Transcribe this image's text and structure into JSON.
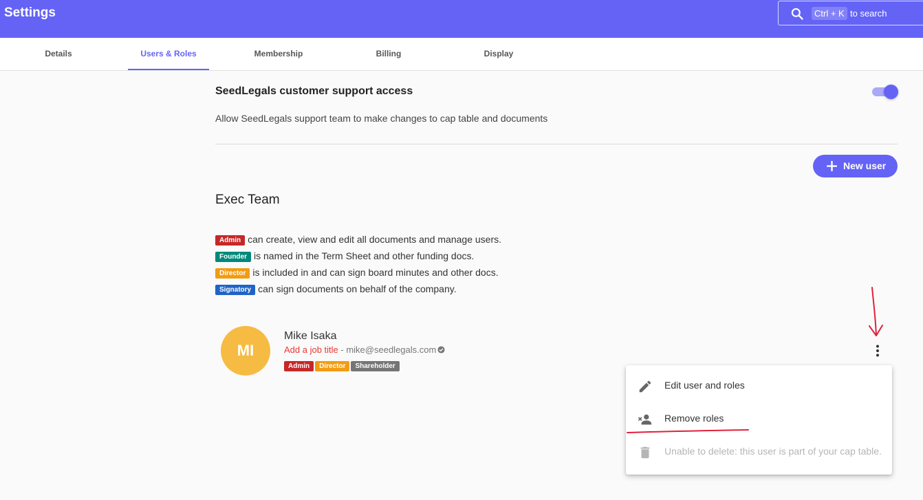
{
  "app": {
    "title": "Settings"
  },
  "search": {
    "shortcut": "Ctrl + K",
    "hint": "to search"
  },
  "tabs": [
    {
      "label": "Details"
    },
    {
      "label": "Users & Roles"
    },
    {
      "label": "Membership"
    },
    {
      "label": "Billing"
    },
    {
      "label": "Display"
    }
  ],
  "support": {
    "title": "SeedLegals customer support access",
    "description": "Allow SeedLegals support team to make changes to cap table and documents",
    "enabled": true
  },
  "actions": {
    "new_user_label": "New user"
  },
  "group": {
    "title": "Exec Team",
    "roles": [
      {
        "chip": "Admin",
        "text": "can create, view and edit all documents and manage users.",
        "color": "#c62828"
      },
      {
        "chip": "Founder",
        "text": "is named in the Term Sheet and other funding docs.",
        "color": "#00897b"
      },
      {
        "chip": "Director",
        "text": "is included in and can sign board minutes and other docs.",
        "color": "#f29c12"
      },
      {
        "chip": "Signatory",
        "text": "can sign documents on behalf of the company.",
        "color": "#1e64c8"
      }
    ]
  },
  "user": {
    "initials": "MI",
    "name": "Mike Isaka",
    "job_title_prompt": "Add a job title",
    "separator": " - ",
    "email": "mike@seedlegals.com",
    "roles": [
      "Admin",
      "Director",
      "Shareholder"
    ]
  },
  "menu": {
    "items": [
      {
        "label": "Edit user and roles",
        "icon": "pencil-icon",
        "disabled": false
      },
      {
        "label": "Remove roles",
        "icon": "remove-user-icon",
        "disabled": false
      },
      {
        "label": "Unable to delete: this user is part of your cap table.",
        "icon": "trash-icon",
        "disabled": true
      }
    ]
  },
  "colors": {
    "brand": "#6463f6",
    "annotation": "#e0203a",
    "avatar": "#f6bb42"
  }
}
